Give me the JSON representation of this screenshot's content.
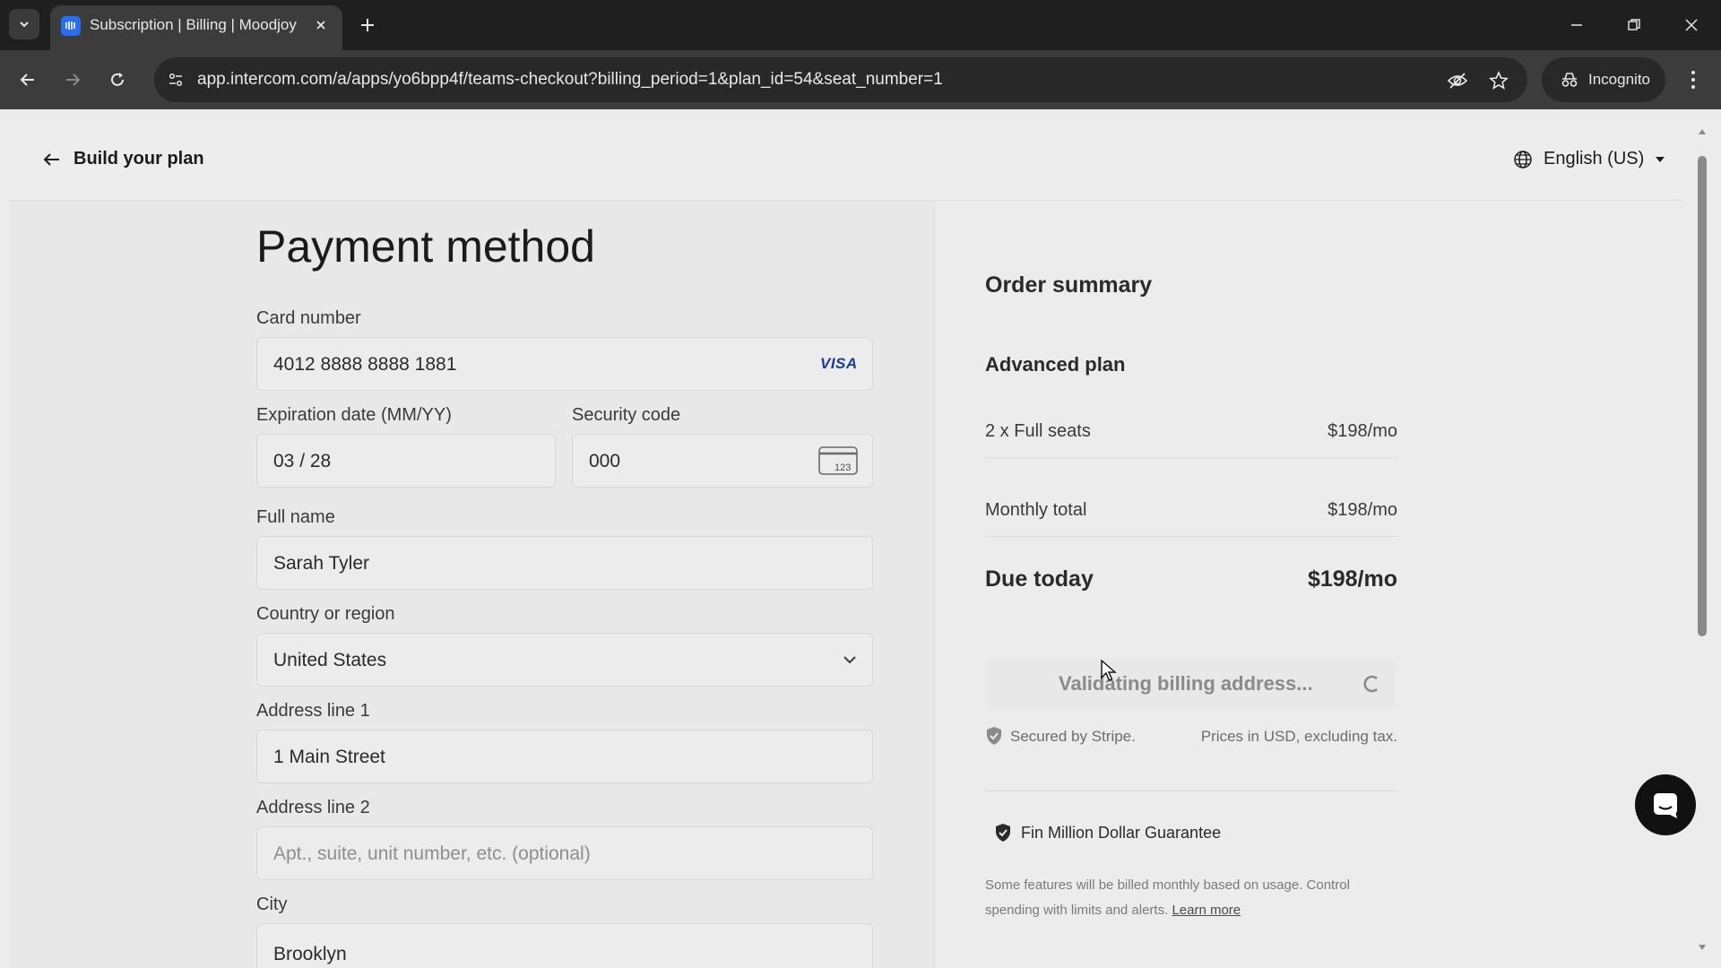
{
  "browser": {
    "tab_title": "Subscription | Billing | Moodjoy",
    "url": "app.intercom.com/a/apps/yo6bpp4f/teams-checkout?billing_period=1&plan_id=54&seat_number=1",
    "incognito_label": "Incognito"
  },
  "header": {
    "back_label": "Build your plan",
    "language": "English (US)"
  },
  "payment": {
    "title": "Payment method",
    "card_number_label": "Card number",
    "card_number_value": "4012 8888 8888 1881",
    "card_brand": "VISA",
    "expiration_label": "Expiration date (MM/YY)",
    "expiration_value": "03 / 28",
    "security_label": "Security code",
    "security_value": "000",
    "cvc_icon_text": "123",
    "full_name_label": "Full name",
    "full_name_value": "Sarah Tyler",
    "country_label": "Country or region",
    "country_value": "United States",
    "address1_label": "Address line 1",
    "address1_value": "1 Main Street",
    "address2_label": "Address line 2",
    "address2_placeholder": "Apt., suite, unit number, etc. (optional)",
    "city_label": "City",
    "city_value": "Brooklyn"
  },
  "order": {
    "title": "Order summary",
    "plan_name": "Advanced plan",
    "seats_label": "2 x Full seats",
    "seats_price": "$198/mo",
    "monthly_total_label": "Monthly total",
    "monthly_total_value": "$198/mo",
    "due_today_label": "Due today",
    "due_today_value": "$198/mo",
    "validate_button": "Validating billing address...",
    "secured_label": "Secured by Stripe.",
    "prices_note": "Prices in USD, excluding tax.",
    "guarantee_label": "Fin Million Dollar Guarantee",
    "fine_print": "Some features will be billed monthly based on usage. Control spending with limits and alerts.",
    "learn_more": "Learn more"
  },
  "colors": {
    "visa_blue": "#1a3c97",
    "intercom_blue": "#2a6ef0"
  }
}
